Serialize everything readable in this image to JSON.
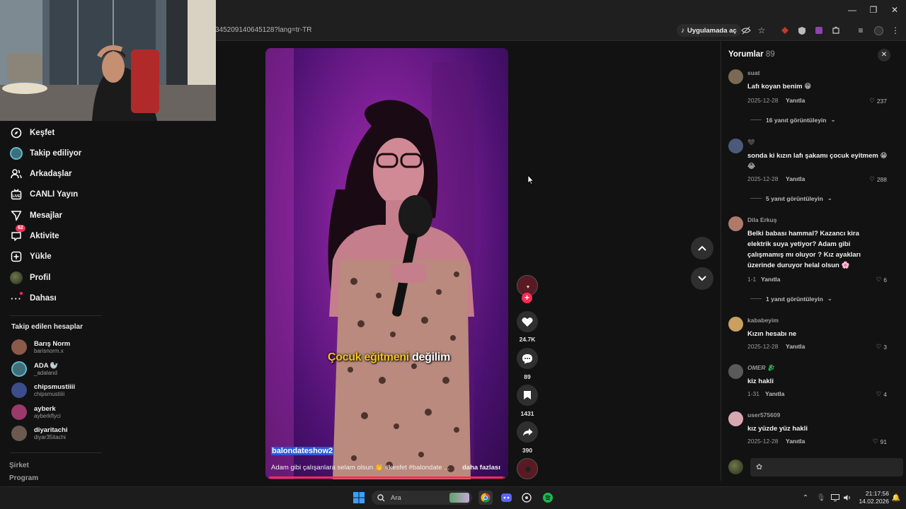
{
  "browser": {
    "url": "345209140645128?lang=tr-TR",
    "open_app_label": "Uygulamada aç"
  },
  "sidebar": {
    "nav": [
      {
        "label": "Keşfet",
        "icon": "compass-icon"
      },
      {
        "label": "Takip ediliyor",
        "icon": "following-avatar-icon"
      },
      {
        "label": "Arkadaşlar",
        "icon": "friends-icon"
      },
      {
        "label": "CANLI Yayın",
        "icon": "live-icon"
      },
      {
        "label": "Mesajlar",
        "icon": "send-icon"
      },
      {
        "label": "Aktivite",
        "icon": "activity-icon",
        "badge": "62"
      },
      {
        "label": "Yükle",
        "icon": "upload-icon"
      },
      {
        "label": "Profil",
        "icon": "profile-avatar-icon"
      },
      {
        "label": "Dahası",
        "icon": "more-icon"
      }
    ],
    "following_title": "Takip edilen hesaplar",
    "accounts": [
      {
        "name": "Barış Norm",
        "handle": "barisnorm.x",
        "color": "#8a5a4a"
      },
      {
        "name": "ADA 🦭",
        "handle": "_adaland",
        "color": "#3d6e7a"
      },
      {
        "name": "chipsmustiiii",
        "handle": "chipsmustiiii",
        "color": "#3b4d8a"
      },
      {
        "name": "ayberk",
        "handle": "ayberkflyci",
        "color": "#9a3a6a"
      },
      {
        "name": "diyaritachi",
        "handle": "diyar35itachi",
        "color": "#6a5a50"
      }
    ],
    "footer": [
      "Şirket",
      "Program"
    ]
  },
  "video": {
    "caption_highlight": "Çocuk eğitmeni",
    "caption_rest": " değilim",
    "username": "balondateshow2",
    "description": "Adam gibi çalışanlara selam olsun 👏 #kesfet #balondate ...",
    "more": "daha fazlası",
    "progress": 0.99
  },
  "actions": {
    "likes": "24.7K",
    "comments": "89",
    "saves": "1431",
    "shares": "390"
  },
  "comments": {
    "title": "Yorumlar",
    "count": "89",
    "reply_label": "Yanıtla",
    "items": [
      {
        "user": "suat",
        "text": "Lafı koyan benim 😁",
        "date": "2025-12-28",
        "likes": "237",
        "view_replies": "16 yanıt görüntüleyin",
        "avatar": "#7a6a55"
      },
      {
        "user": "🖤",
        "text": "sonda ki kızın lafı şakamı çocuk eyitmem 😁😂",
        "date": "2025-12-28",
        "likes": "288",
        "view_replies": "5 yanıt görüntüleyin",
        "avatar": "#4a5a7a"
      },
      {
        "user": "Dila Erkuş",
        "text": "Belki babası hammal? Kazancı kira elektrik suya yetiyor? Adam gibi çalışmamış mı oluyor ? Kız ayakları üzerinde duruyor helal olsun 🌸",
        "date": "1-1",
        "likes": "6",
        "view_replies": "1 yanıt görüntüleyin",
        "avatar": "#b07a6a"
      },
      {
        "user": "kababeyim",
        "text": "Kızın hesabı ne",
        "date": "2025-12-28",
        "likes": "3",
        "view_replies": "",
        "avatar": "#c9a060"
      },
      {
        "user": "OMER 🐉",
        "text": "kiz hakli",
        "date": "1-31",
        "likes": "4",
        "view_replies": "",
        "avatar": "#5a5a5a"
      },
      {
        "user": "user575609",
        "text": "kız yüzde yüz hakli",
        "date": "2025-12-28",
        "likes": "91",
        "view_replies": "",
        "avatar": "#d8a8b0"
      }
    ]
  },
  "taskbar": {
    "search_placeholder": "Ara",
    "time": "21:17:56",
    "date": "14.02.2026"
  },
  "colors": {
    "accent": "#fe2c55",
    "background": "#121212"
  }
}
